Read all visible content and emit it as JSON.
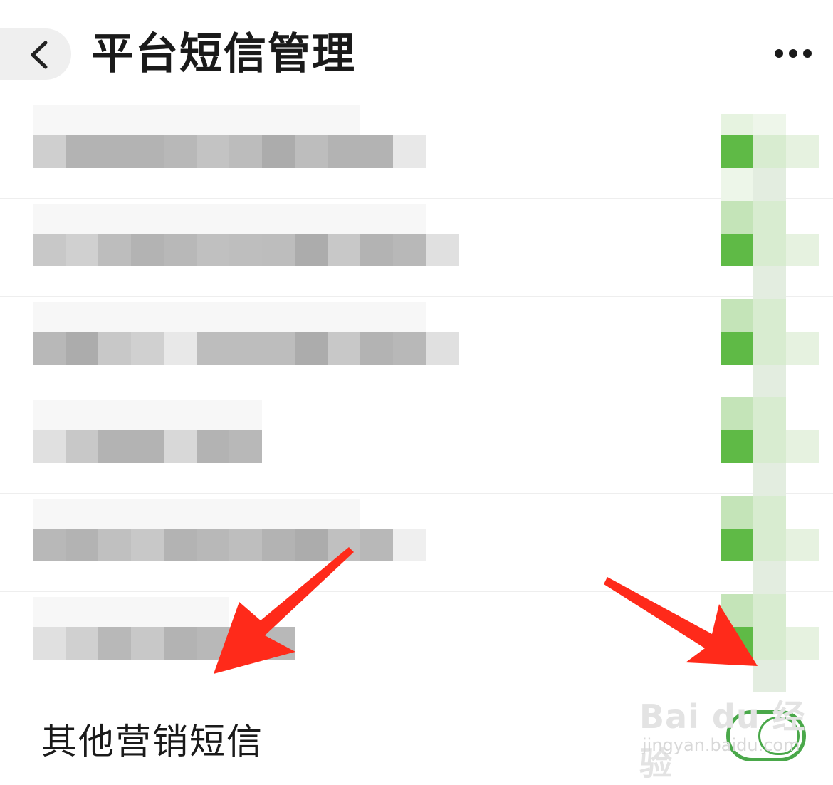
{
  "header": {
    "title": "平台短信管理",
    "back_icon": "chevron-left-icon",
    "more_icon": "more-horizontal-icon"
  },
  "rows": [
    {
      "label": "",
      "enabled": true
    },
    {
      "label": "",
      "enabled": true
    },
    {
      "label": "",
      "enabled": true
    },
    {
      "label": "",
      "enabled": true
    },
    {
      "label": "",
      "enabled": true
    },
    {
      "label": "",
      "enabled": true
    }
  ],
  "last_row": {
    "label": "其他营销短信",
    "enabled": true
  },
  "watermark": {
    "logo": "Bai du 经验",
    "url": "jingyan.baidu.com"
  },
  "colors": {
    "accent_green": "#5fba46",
    "annotation_red": "#ff2a1a"
  }
}
